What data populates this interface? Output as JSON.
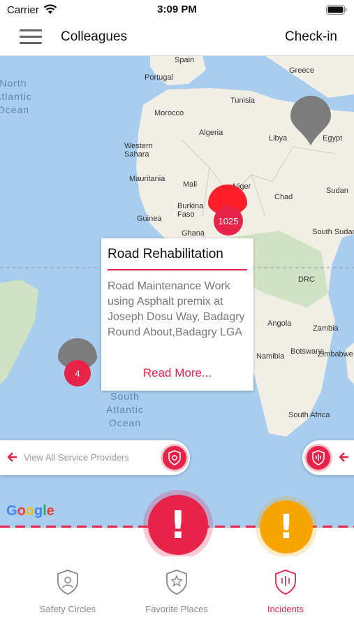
{
  "status_bar": {
    "carrier": "Carrier",
    "time": "3:09 PM"
  },
  "nav": {
    "title": "Colleagues",
    "checkin_label": "Check-in"
  },
  "map": {
    "ocean_labels": {
      "north_atlantic": "North\nAtlantic\nOcean",
      "south_atlantic": "South\nAtlantic\nOcean"
    },
    "places": [
      "Spain",
      "Portugal",
      "Greece",
      "Tunisia",
      "Morocco",
      "Algeria",
      "Libya",
      "Egypt",
      "Western\nSahara",
      "Mauritania",
      "Mali",
      "Niger",
      "Chad",
      "Sudan",
      "Burkina\nFaso",
      "Guinea",
      "Ghana",
      "South Sudan",
      "DRC",
      "Angola",
      "Zambia",
      "Namibia",
      "Zimbabwe",
      "Botswana",
      "South Africa"
    ],
    "clusters": {
      "main_count": "1025",
      "west_count": "4"
    },
    "attribution": "Google"
  },
  "popup": {
    "title": "Road Rehabilitation",
    "body": "Road Maintenance Work using Asphalt premix at Joseph Dosu Way, Badagry Round About,Badagry LGA",
    "link": "Read More..."
  },
  "providers": {
    "label": "View All Service Providers"
  },
  "tabs": [
    {
      "label": "Safety Circles",
      "icon": "safety-circles-icon"
    },
    {
      "label": "Favorite Places",
      "icon": "favorite-places-icon"
    },
    {
      "label": "Incidents",
      "icon": "incidents-icon",
      "active": true
    }
  ],
  "colors": {
    "accent": "#e8234a",
    "warning": "#f8a400",
    "water": "#a8cdee",
    "land": "#f1eee6"
  }
}
